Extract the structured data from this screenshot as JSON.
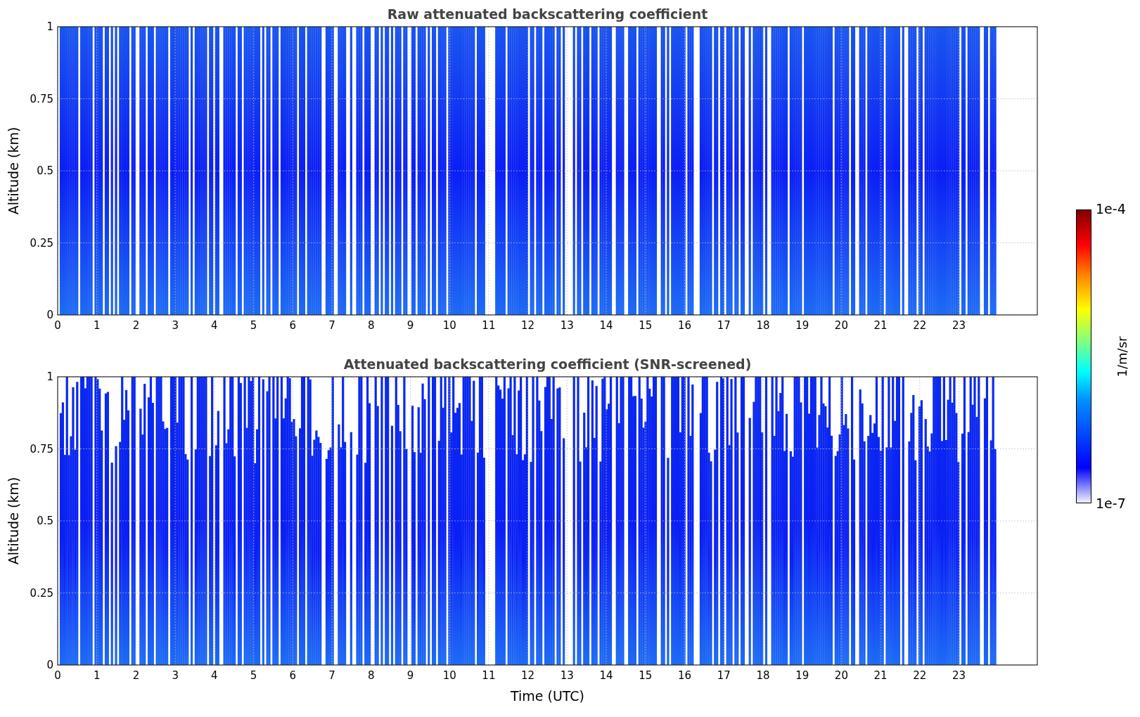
{
  "panels": [
    {
      "kind": "raw",
      "title": "Raw attenuated backscattering coefficient",
      "ylabel": "Altitude (km)",
      "yticks": [
        "1",
        "0.75",
        "0.5",
        "0.25",
        "0"
      ],
      "xticks": [
        "0",
        "1",
        "2",
        "3",
        "4",
        "5",
        "6",
        "7",
        "8",
        "9",
        "10",
        "11",
        "12",
        "13",
        "14",
        "15",
        "16",
        "17",
        "18",
        "19",
        "20",
        "21",
        "22",
        "23"
      ]
    },
    {
      "kind": "screened",
      "title": "Attenuated backscattering coefficient (SNR-screened)",
      "ylabel": "Altitude (km)",
      "yticks": [
        "1",
        "0.75",
        "0.5",
        "0.25",
        "0"
      ],
      "xticks": [
        "0",
        "1",
        "2",
        "3",
        "4",
        "5",
        "6",
        "7",
        "8",
        "9",
        "10",
        "11",
        "12",
        "13",
        "14",
        "15",
        "16",
        "17",
        "18",
        "19",
        "20",
        "21",
        "22",
        "23"
      ]
    }
  ],
  "xlabel": "Time (UTC)",
  "colorbar": {
    "max": "1e-4",
    "min": "1e-7",
    "label": "1/m/sr"
  }
}
